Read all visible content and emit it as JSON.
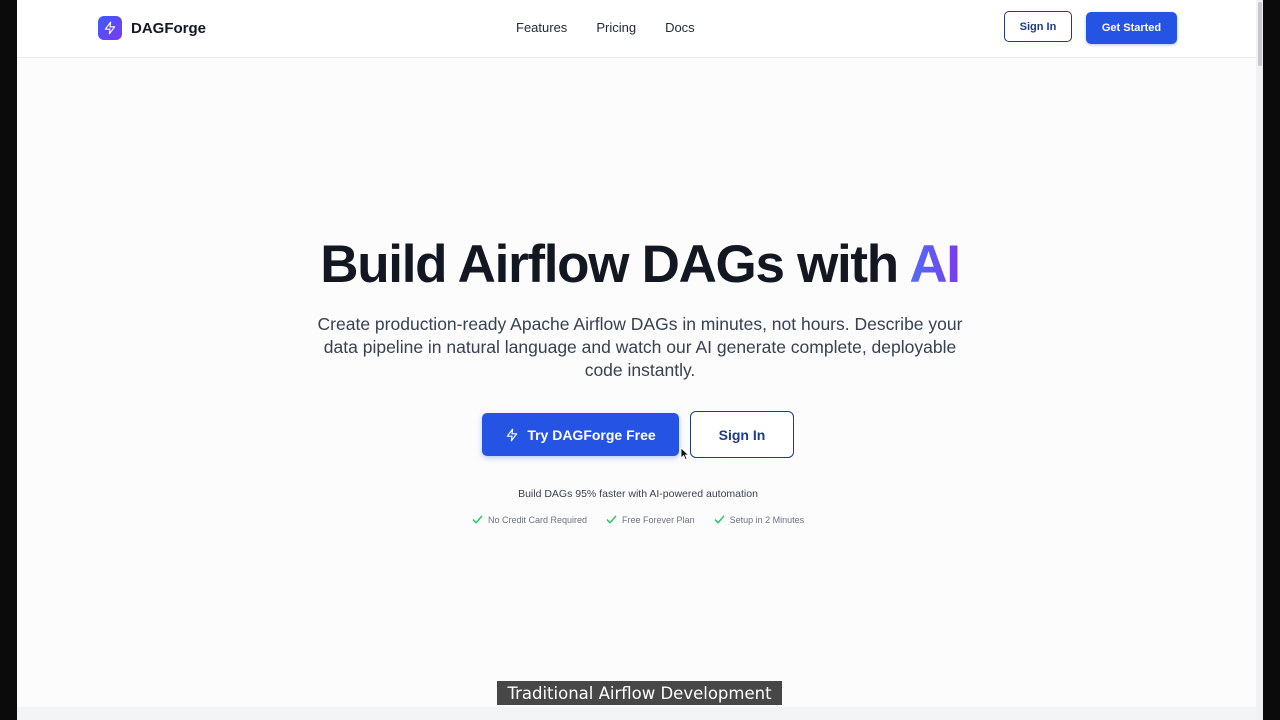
{
  "nav": {
    "brand": "DAGForge",
    "links": [
      "Features",
      "Pricing",
      "Docs"
    ],
    "sign_in": "Sign In",
    "get_started": "Get Started"
  },
  "hero": {
    "title_main": "Build Airflow DAGs with ",
    "title_accent": "AI",
    "subtitle": "Create production-ready Apache Airflow DAGs in minutes, not hours. Describe your data pipeline in natural language and watch our AI generate complete, deployable code instantly.",
    "primary_cta": "Try DAGForge Free",
    "secondary_cta": "Sign In",
    "tagline": "Build DAGs 95% faster with AI-powered automation",
    "perks": [
      "No Credit Card Required",
      "Free Forever Plan",
      "Setup in 2 Minutes"
    ]
  },
  "caption": "Traditional Airflow Development",
  "colors": {
    "primary": "#2554e5",
    "outline": "#1e3a8a",
    "accent_start": "#4f6ef7",
    "accent_end": "#7c3aed",
    "check": "#22c55e"
  },
  "icons": {
    "brand": "lightning-bolt-icon",
    "primary_cta": "lightning-bolt-icon",
    "perk": "check-icon"
  }
}
